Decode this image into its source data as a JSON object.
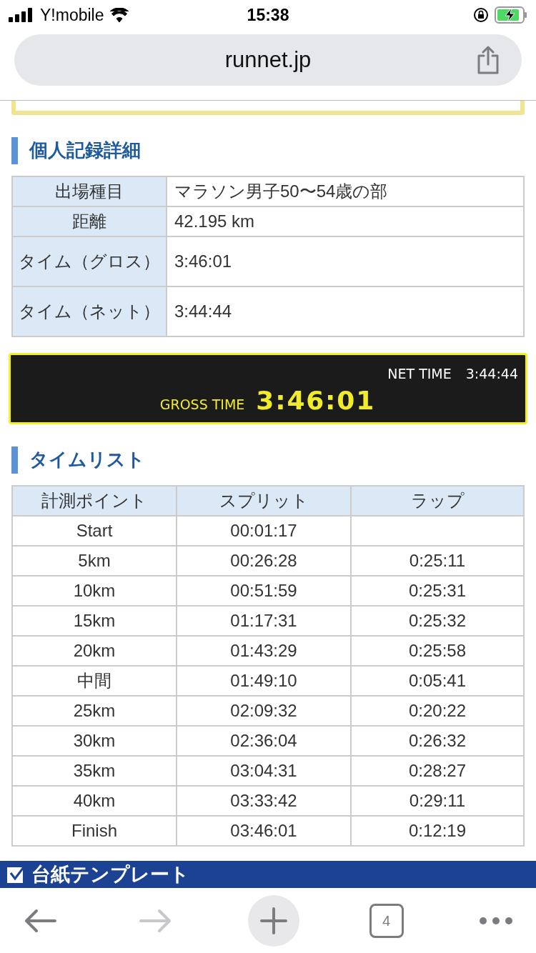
{
  "status_bar": {
    "carrier": "Y!mobile",
    "time": "15:38"
  },
  "address_bar": {
    "url": "runnet.jp"
  },
  "record_section": {
    "title": "個人記録詳細",
    "rows": [
      {
        "label": "出場種目",
        "value": "マラソン男子50〜54歳の部"
      },
      {
        "label": "距離",
        "value": "42.195 km"
      },
      {
        "label": "タイム（グロス）",
        "value": "3:46:01"
      },
      {
        "label": "タイム（ネット）",
        "value": "3:44:44"
      }
    ]
  },
  "scoreboard": {
    "net_label": "NET TIME",
    "net_time": "3:44:44",
    "gross_label": "GROSS TIME",
    "gross_time": "3:46:01"
  },
  "time_list": {
    "title": "タイムリスト",
    "columns": [
      "計測ポイント",
      "スプリット",
      "ラップ"
    ],
    "rows": [
      [
        "Start",
        "00:01:17",
        ""
      ],
      [
        "5km",
        "00:26:28",
        "0:25:11"
      ],
      [
        "10km",
        "00:51:59",
        "0:25:31"
      ],
      [
        "15km",
        "01:17:31",
        "0:25:32"
      ],
      [
        "20km",
        "01:43:29",
        "0:25:58"
      ],
      [
        "中間",
        "01:49:10",
        "0:05:41"
      ],
      [
        "25km",
        "02:09:32",
        "0:20:22"
      ],
      [
        "30km",
        "02:36:04",
        "0:26:32"
      ],
      [
        "35km",
        "03:04:31",
        "0:28:27"
      ],
      [
        "40km",
        "03:33:42",
        "0:29:11"
      ],
      [
        "Finish",
        "03:46:01",
        "0:12:19"
      ]
    ]
  },
  "template_bar": {
    "title": "台紙テンプレート"
  },
  "toolbar": {
    "back": {
      "disabled": false
    },
    "forward": {
      "disabled": true
    },
    "tab_count": "4"
  }
}
